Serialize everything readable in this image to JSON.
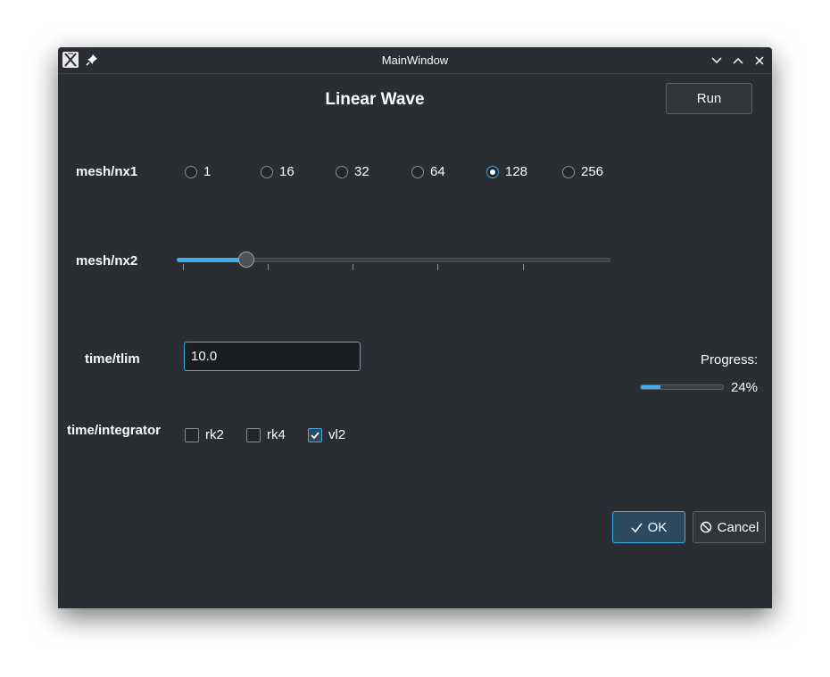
{
  "window": {
    "title": "MainWindow",
    "icons": [
      "app-icon",
      "pin-icon",
      "minimize-icon",
      "maximize-icon",
      "close-icon"
    ]
  },
  "header": {
    "title": "Linear Wave",
    "run_label": "Run"
  },
  "mesh_nx1": {
    "label": "mesh/nx1",
    "options": [
      "1",
      "16",
      "32",
      "64",
      "128",
      "256"
    ],
    "selected": "128"
  },
  "mesh_nx2": {
    "label": "mesh/nx2",
    "slider_fraction": 0.16
  },
  "time_tlim": {
    "label": "time/tlim",
    "value": "10.0"
  },
  "progress": {
    "label": "Progress:",
    "value_text": "24%",
    "value": 0.24
  },
  "time_integrator": {
    "label": "time/integrator",
    "options": [
      {
        "label": "rk2",
        "checked": false
      },
      {
        "label": "rk4",
        "checked": false
      },
      {
        "label": "vl2",
        "checked": true
      }
    ]
  },
  "dialog_buttons": {
    "ok_label": "OK",
    "cancel_label": "Cancel"
  },
  "colors": {
    "background": "#2a2e32",
    "accent": "#3daee9",
    "text": "#fcfcfc"
  }
}
